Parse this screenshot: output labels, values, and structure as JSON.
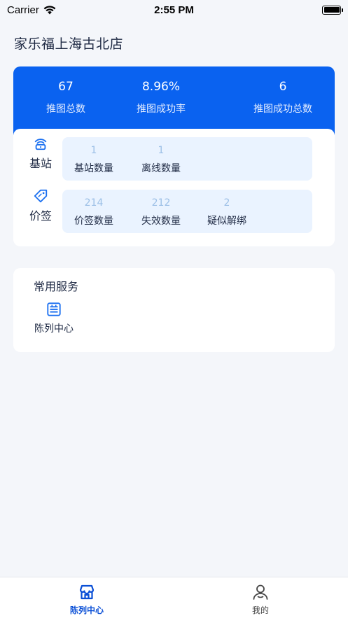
{
  "status_bar": {
    "carrier": "Carrier",
    "time": "2:55 PM"
  },
  "store": {
    "title": "家乐福上海古北店"
  },
  "stats": [
    {
      "value": "67",
      "label": "推图总数"
    },
    {
      "value": "8.96%",
      "label": "推图成功率"
    },
    {
      "value": "6",
      "label": "推图成功总数"
    }
  ],
  "base_station": {
    "name": "基站",
    "metrics": [
      {
        "value": "1",
        "label": "基站数量"
      },
      {
        "value": "1",
        "label": "离线数量"
      }
    ]
  },
  "price_tag": {
    "name": "价签",
    "metrics": [
      {
        "value": "214",
        "label": "价签数量"
      },
      {
        "value": "212",
        "label": "失效数量"
      },
      {
        "value": "2",
        "label": "疑似解绑"
      }
    ]
  },
  "services": {
    "title": "常用服务",
    "items": [
      {
        "label": "陈列中心",
        "icon": "display-rack-icon"
      }
    ]
  },
  "tabs": [
    {
      "label": "陈列中心",
      "icon": "store-icon",
      "active": true
    },
    {
      "label": "我的",
      "icon": "profile-icon",
      "active": false
    }
  ],
  "colors": {
    "accent": "#0a62f0",
    "panel": "#eaf3ff",
    "metric_value": "#9cbfe6"
  }
}
